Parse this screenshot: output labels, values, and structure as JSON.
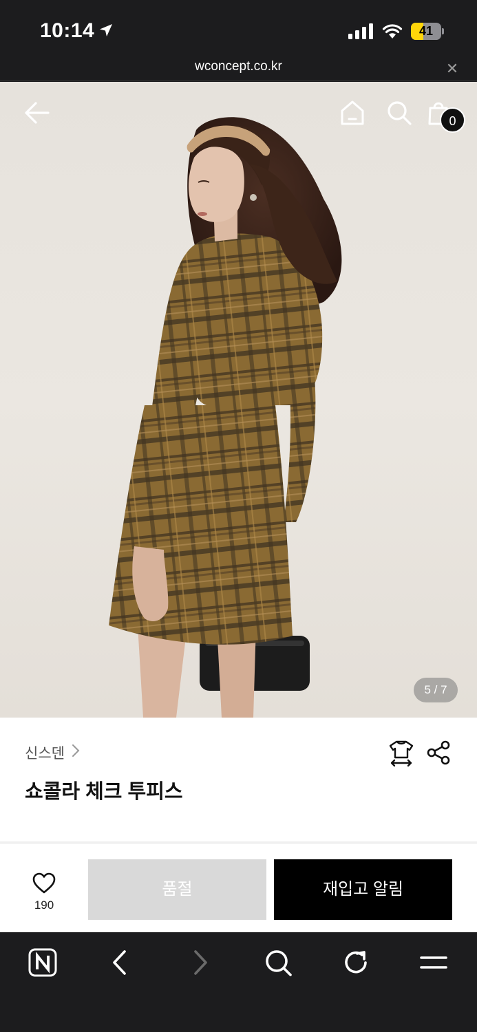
{
  "status_bar": {
    "time": "10:14",
    "battery_level": "41",
    "battery_fraction": 0.41,
    "icons": [
      "location-arrow-icon",
      "cellular-signal-icon",
      "wifi-icon",
      "battery-charging-icon"
    ]
  },
  "browser": {
    "url": "wconcept.co.kr",
    "close_symbol": "✕"
  },
  "header": {
    "cart_count": "0",
    "icons": [
      "back-arrow-icon",
      "home-icon",
      "search-icon",
      "shopping-bag-icon"
    ]
  },
  "gallery": {
    "counter": "5 / 7",
    "current": 5,
    "total": 7
  },
  "product": {
    "brand": "신스덴",
    "title": "쇼콜라 체크 투피스"
  },
  "actions": {
    "like_count": "190",
    "soldout_label": "품절",
    "restock_label": "재입고 알림"
  },
  "colors": {
    "accent": "#000000",
    "soldout_bg": "#d9d9d9",
    "battery_yellow": "#ffd60a",
    "browser_chrome": "#1c1c1e"
  },
  "toolbar": {
    "icons": [
      "naver-n-icon",
      "back-chevron-icon",
      "forward-chevron-icon",
      "search-icon",
      "reload-icon",
      "menu-icon"
    ]
  }
}
